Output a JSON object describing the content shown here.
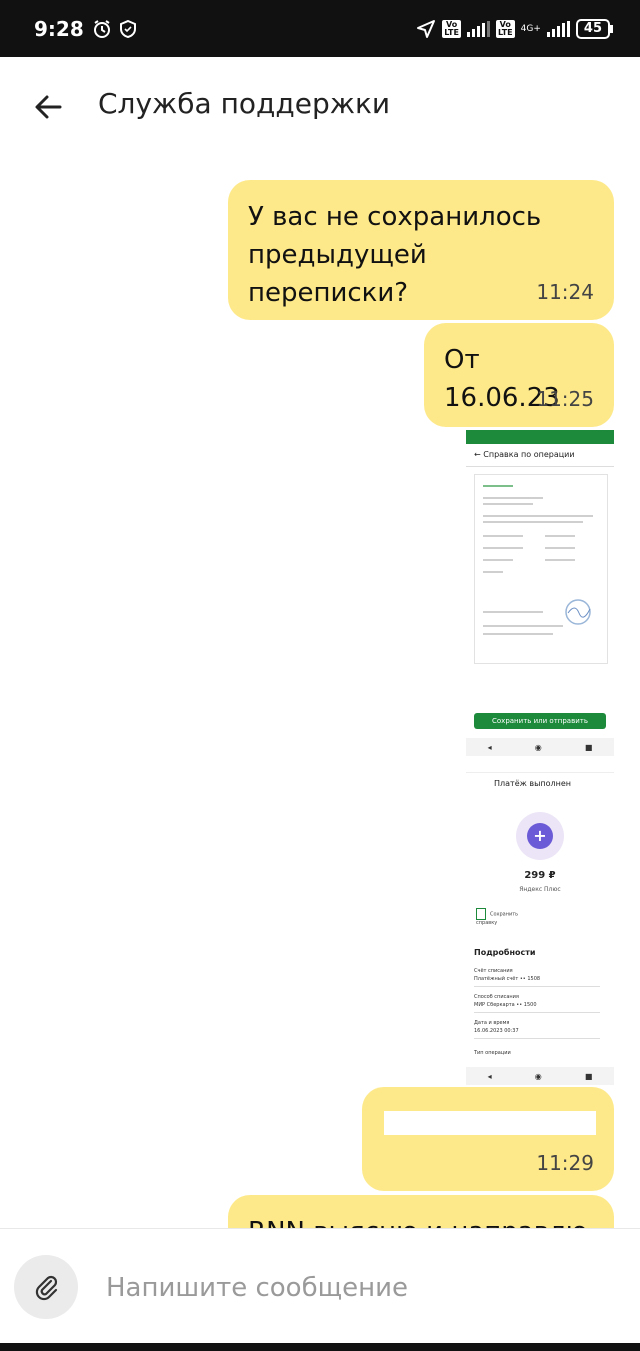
{
  "status": {
    "time": "9:28",
    "volte1": "Vo\nLTE",
    "volte2": "Vo\nLTE",
    "network": "4G+",
    "battery": "45"
  },
  "header": {
    "title": "Служба поддержки"
  },
  "messages": [
    {
      "text": "У вас не сохранилось предыдущей переписки?",
      "time": "11:24"
    },
    {
      "text": "От 16.06.23",
      "time": "11:25"
    },
    {
      "text": "",
      "time": "11:29"
    },
    {
      "text": "RNN выясню и направлю в",
      "time": ""
    }
  ],
  "attachment": {
    "receipt": {
      "header": "Справка по операции",
      "button": "Сохранить или отправить"
    },
    "payment": {
      "title": "Платёж выполнен",
      "amount": "299 ₽",
      "merchant": "Яндекс Плюс",
      "save_label": "Сохранить справку",
      "details_title": "Подробности",
      "account_label": "Счёт списания",
      "account_value": "Платёжный счёт •• 1508",
      "method_label": "Способ списания",
      "method_value": "МИР Сберкарта •• 1500",
      "date_label": "Дата и время",
      "date_value": "16.06.2023 00:37",
      "type_label": "Тип операции"
    }
  },
  "composer": {
    "placeholder": "Напишите сообщение"
  }
}
